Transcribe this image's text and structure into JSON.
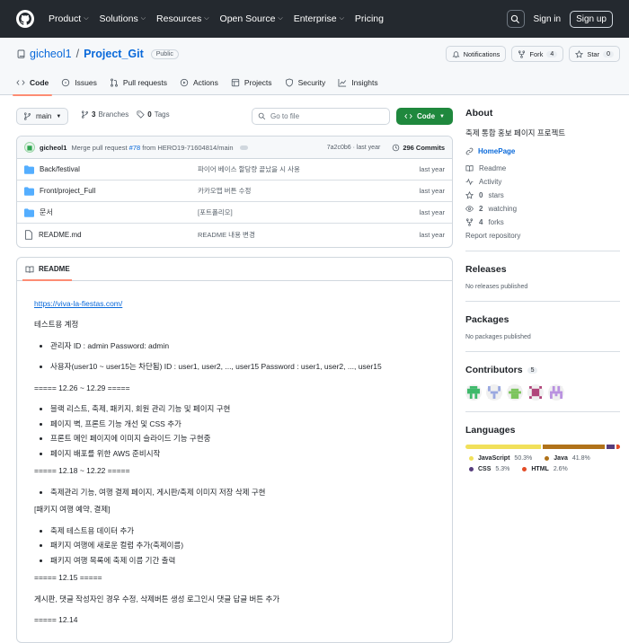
{
  "nav": {
    "items": [
      "Product",
      "Solutions",
      "Resources",
      "Open Source",
      "Enterprise",
      "Pricing"
    ],
    "sign_in": "Sign in",
    "sign_up": "Sign up"
  },
  "repo": {
    "owner": "gicheol1",
    "name": "Project_Git",
    "visibility": "Public",
    "notifications": "Notifications",
    "fork_label": "Fork",
    "fork_count": "4",
    "star_label": "Star",
    "star_count": "0"
  },
  "tabs": [
    "Code",
    "Issues",
    "Pull requests",
    "Actions",
    "Projects",
    "Security",
    "Insights"
  ],
  "toolbar": {
    "branch": "main",
    "branches_count": "3",
    "branches_label": "Branches",
    "tags_count": "0",
    "tags_label": "Tags",
    "goto_placeholder": "Go to file",
    "code_button": "Code"
  },
  "commit": {
    "user": "gicheol1",
    "message_prefix": "Merge pull request",
    "pr": "#78",
    "message_suffix": "from HERO19-71604814/main",
    "hash": "7a2c0b6 · last year",
    "commits": "296 Commits"
  },
  "files": [
    {
      "name": "Back/festival",
      "type": "dir",
      "message": "파이어 베이스 할당량 끝났을 시 사용",
      "date": "last year"
    },
    {
      "name": "Front/project_Full",
      "type": "dir",
      "message": "카카오맵 버튼 수정",
      "date": "last year"
    },
    {
      "name": "문서",
      "type": "dir",
      "message": "[포트폴리오]",
      "date": "last year"
    },
    {
      "name": "README.md",
      "type": "file",
      "message": "README 내용 변경",
      "date": "last year"
    }
  ],
  "readme": {
    "title": "README",
    "link": "https://viva-la-fiestas.com/",
    "test_accounts": "테스트용 계정",
    "accounts": [
      "관리자 ID : admin Password: admin",
      "사용자(user10 ~ user15는 차단됨) ID : user1, user2, ..., user15 Password : user1, user2, ..., user15"
    ],
    "section1": "===== 12.26 ~ 12.29 =====",
    "section1_items": [
      "블랙 리스트, 축제, 패키지, 회원 관리 기능 및 페이지 구현",
      "페이지 벽, 프론트 기능 개선 및 CSS 추가",
      "프론트 메인 페이지에 이미지 슬라이드 기능 구현중",
      "페이지 배포를 위한 AWS 준비시작"
    ],
    "section2": "===== 12.18 ~ 12.22 =====",
    "section2_items": [
      "축제관리 기능, 여행 결제 페이지, 게시판/축제 이미지 저장 삭제 구현"
    ],
    "section3": "[패키지 여행 예약, 결제]",
    "section3_items": [
      "축제 테스트용 데이터 추가",
      "패키지 여행에 새로운 컬럼 추가(축제이름)",
      "패키지 여행 목록에 축제 이름 기간 출력"
    ],
    "section4": "===== 12.15 =====",
    "section4_text": "게시판, 댓글 작성자인 경우 수정, 삭제버튼 생성 로그인시 댓글 답글 버튼 추가",
    "section5": "===== 12.14"
  },
  "about": {
    "title": "About",
    "description": "축제 통합 홍보 페이지 프로젝트",
    "homepage": "HomePage",
    "readme": "Readme",
    "activity": "Activity",
    "stars": "0",
    "stars_label": "stars",
    "watching": "2",
    "watching_label": "watching",
    "forks": "4",
    "forks_label": "forks",
    "report": "Report repository"
  },
  "releases": {
    "title": "Releases",
    "text": "No releases published"
  },
  "packages": {
    "title": "Packages",
    "text": "No packages published"
  },
  "contributors": {
    "title": "Contributors",
    "count": "5"
  },
  "languages": {
    "title": "Languages",
    "items": [
      {
        "name": "JavaScript",
        "percent": "50.3%",
        "value": 50.3,
        "color": "#f1e05a"
      },
      {
        "name": "Java",
        "percent": "41.8%",
        "value": 41.8,
        "color": "#b07219"
      },
      {
        "name": "CSS",
        "percent": "5.3%",
        "value": 5.3,
        "color": "#563d7c"
      },
      {
        "name": "HTML",
        "percent": "2.6%",
        "value": 2.6,
        "color": "#e34c26"
      }
    ]
  }
}
